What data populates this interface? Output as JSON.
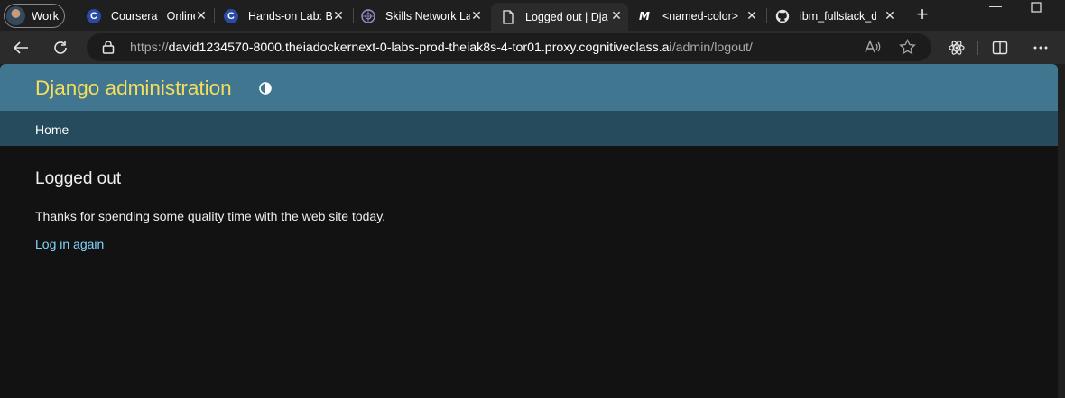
{
  "profile": {
    "label": "Work"
  },
  "tabs": [
    {
      "title": "Coursera | Online",
      "icon": "coursera-icon"
    },
    {
      "title": "Hands-on Lab: B",
      "icon": "coursera-icon"
    },
    {
      "title": "Skills Network La",
      "icon": "skills-network-icon"
    },
    {
      "title": "Logged out | Dja",
      "icon": "page-icon",
      "active": true
    },
    {
      "title": "<named-color>",
      "icon": "mdn-icon"
    },
    {
      "title": "ibm_fullstack_de",
      "icon": "github-icon"
    }
  ],
  "address": {
    "scheme": "https://",
    "host": "david1234570-8000.theiadockernext-0-labs-prod-theiak8s-4-tor01.proxy.cognitiveclass.ai",
    "path": "/admin/logout/"
  },
  "django": {
    "site_header": "Django administration",
    "breadcrumb_home": "Home",
    "content_title": "Logged out",
    "message": "Thanks for spending some quality time with the web site today.",
    "login_again": "Log in again"
  },
  "colors": {
    "header_bg": "#417690",
    "breadcrumb_bg": "#264b5d",
    "branding": "#f5dd5d",
    "link": "#81d4fa",
    "page_bg": "#121212"
  }
}
